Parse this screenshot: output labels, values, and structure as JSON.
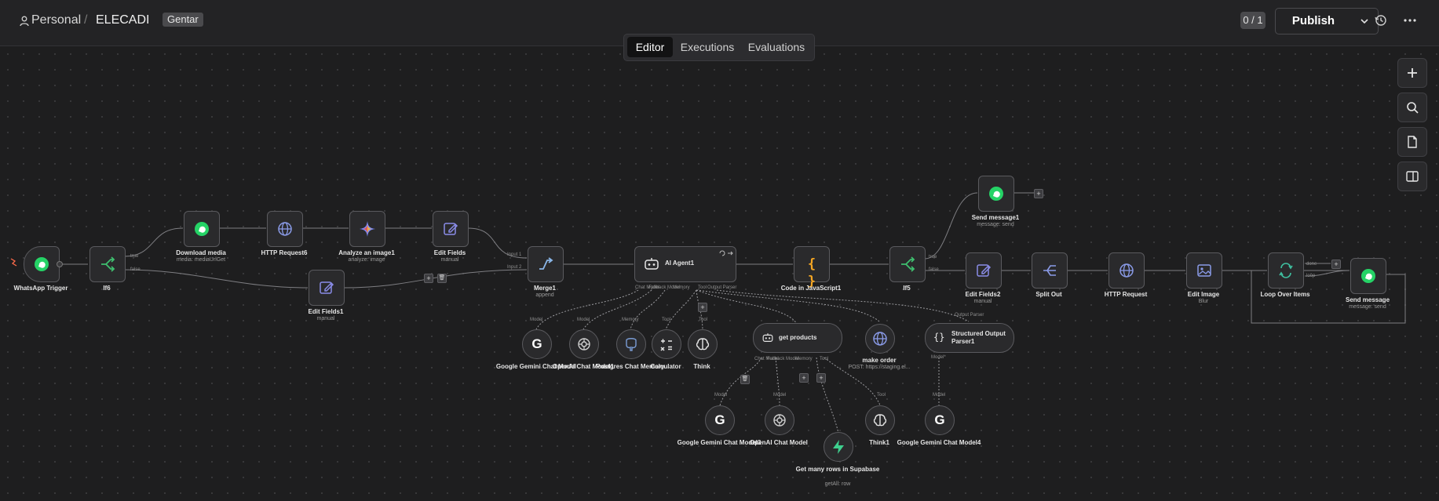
{
  "header": {
    "project_label": "Personal",
    "separator": "/",
    "workflow_name": "ELECADI",
    "tag": "Gentar",
    "counter": "0 / 1",
    "publish_label": "Publish",
    "icons": [
      "user-icon",
      "history-icon",
      "more-icon",
      "chevron-down-icon"
    ]
  },
  "tabs": [
    {
      "label": "Editor",
      "active": true
    },
    {
      "label": "Executions",
      "active": false
    },
    {
      "label": "Evaluations",
      "active": false
    }
  ],
  "side_toolbar": [
    "plus-icon",
    "search-icon",
    "sticky-note-icon",
    "panel-icon"
  ],
  "colors": {
    "background": "#1e1e1f",
    "node_fill": "#2a2a2c",
    "whatsapp": "#25d366",
    "if_green": "#3fbf6f",
    "edit_purple": "#8a8ce8",
    "http_blue": "#8a9be8",
    "code_orange": "#f5a623",
    "supabase": "#3ecf8e"
  },
  "nodes": {
    "whatsapp_trigger": {
      "label": "WhatsApp Trigger"
    },
    "if6": {
      "label": "If6",
      "out_true": "true",
      "out_false": "false"
    },
    "download_media": {
      "label": "Download media",
      "sub": "media: mediaUrlGet"
    },
    "http_request6": {
      "label": "HTTP Request6"
    },
    "analyze_image1": {
      "label": "Analyze an image1",
      "sub": "analyze: image"
    },
    "edit_fields": {
      "label": "Edit Fields",
      "sub": "manual"
    },
    "edit_fields1": {
      "label": "Edit Fields1",
      "sub": "manual"
    },
    "merge1": {
      "label": "Merge1",
      "sub": "append",
      "in1": "Input 1",
      "in2": "Input 2"
    },
    "ai_agent1": {
      "label": "AI Agent1",
      "ports": [
        "Chat Model",
        "Fallback Model",
        "Memory",
        "Tool",
        "Output Parser"
      ]
    },
    "code_js": {
      "label": "Code in JavaScript1"
    },
    "if5": {
      "label": "If5",
      "out_true": "true",
      "out_false": "false"
    },
    "send_message1": {
      "label": "Send message1",
      "sub": "message: send"
    },
    "edit_fields2": {
      "label": "Edit Fields2",
      "sub": "manual"
    },
    "split_out": {
      "label": "Split Out"
    },
    "http_request": {
      "label": "HTTP Request"
    },
    "edit_image": {
      "label": "Edit Image",
      "sub": "Blur"
    },
    "loop_over_items": {
      "label": "Loop Over Items",
      "out_done": "done",
      "out_loop": "loop"
    },
    "send_message": {
      "label": "Send message",
      "sub": "message: send"
    },
    "google_gemini_chat_model": {
      "label": "Google Gemini Chat Model",
      "port": "Model"
    },
    "openai_chat_model1": {
      "label": "OpenAI Chat Model1",
      "port": "Model"
    },
    "postgres_chat_memory": {
      "label": "Postgres Chat Memory",
      "port": "Memory"
    },
    "calculator": {
      "label": "Calculator",
      "port": "Tool"
    },
    "think": {
      "label": "Think",
      "port": "Tool"
    },
    "get_products": {
      "label": "get products",
      "ports": [
        "Chat Model",
        "Fallback Model",
        "Memory",
        "Tool"
      ]
    },
    "make_order": {
      "label": "make order",
      "sub": "POST: https://staging.el..."
    },
    "structured_output_parser1": {
      "label": "Structured Output Parser1",
      "port": "Output Parser",
      "model_port": "Model*"
    },
    "google_gemini_chat_model3": {
      "label": "Google Gemini Chat Model3",
      "port": "Model"
    },
    "openai_chat_model": {
      "label": "OpenAI Chat Model",
      "port": "Model"
    },
    "get_many_rows_supabase": {
      "label": "Get many rows in Supabase",
      "sub": "getAll: row"
    },
    "think1": {
      "label": "Think1",
      "port": "Tool"
    },
    "google_gemini_chat_model4": {
      "label": "Google Gemini Chat Model4",
      "port": "Model"
    }
  }
}
